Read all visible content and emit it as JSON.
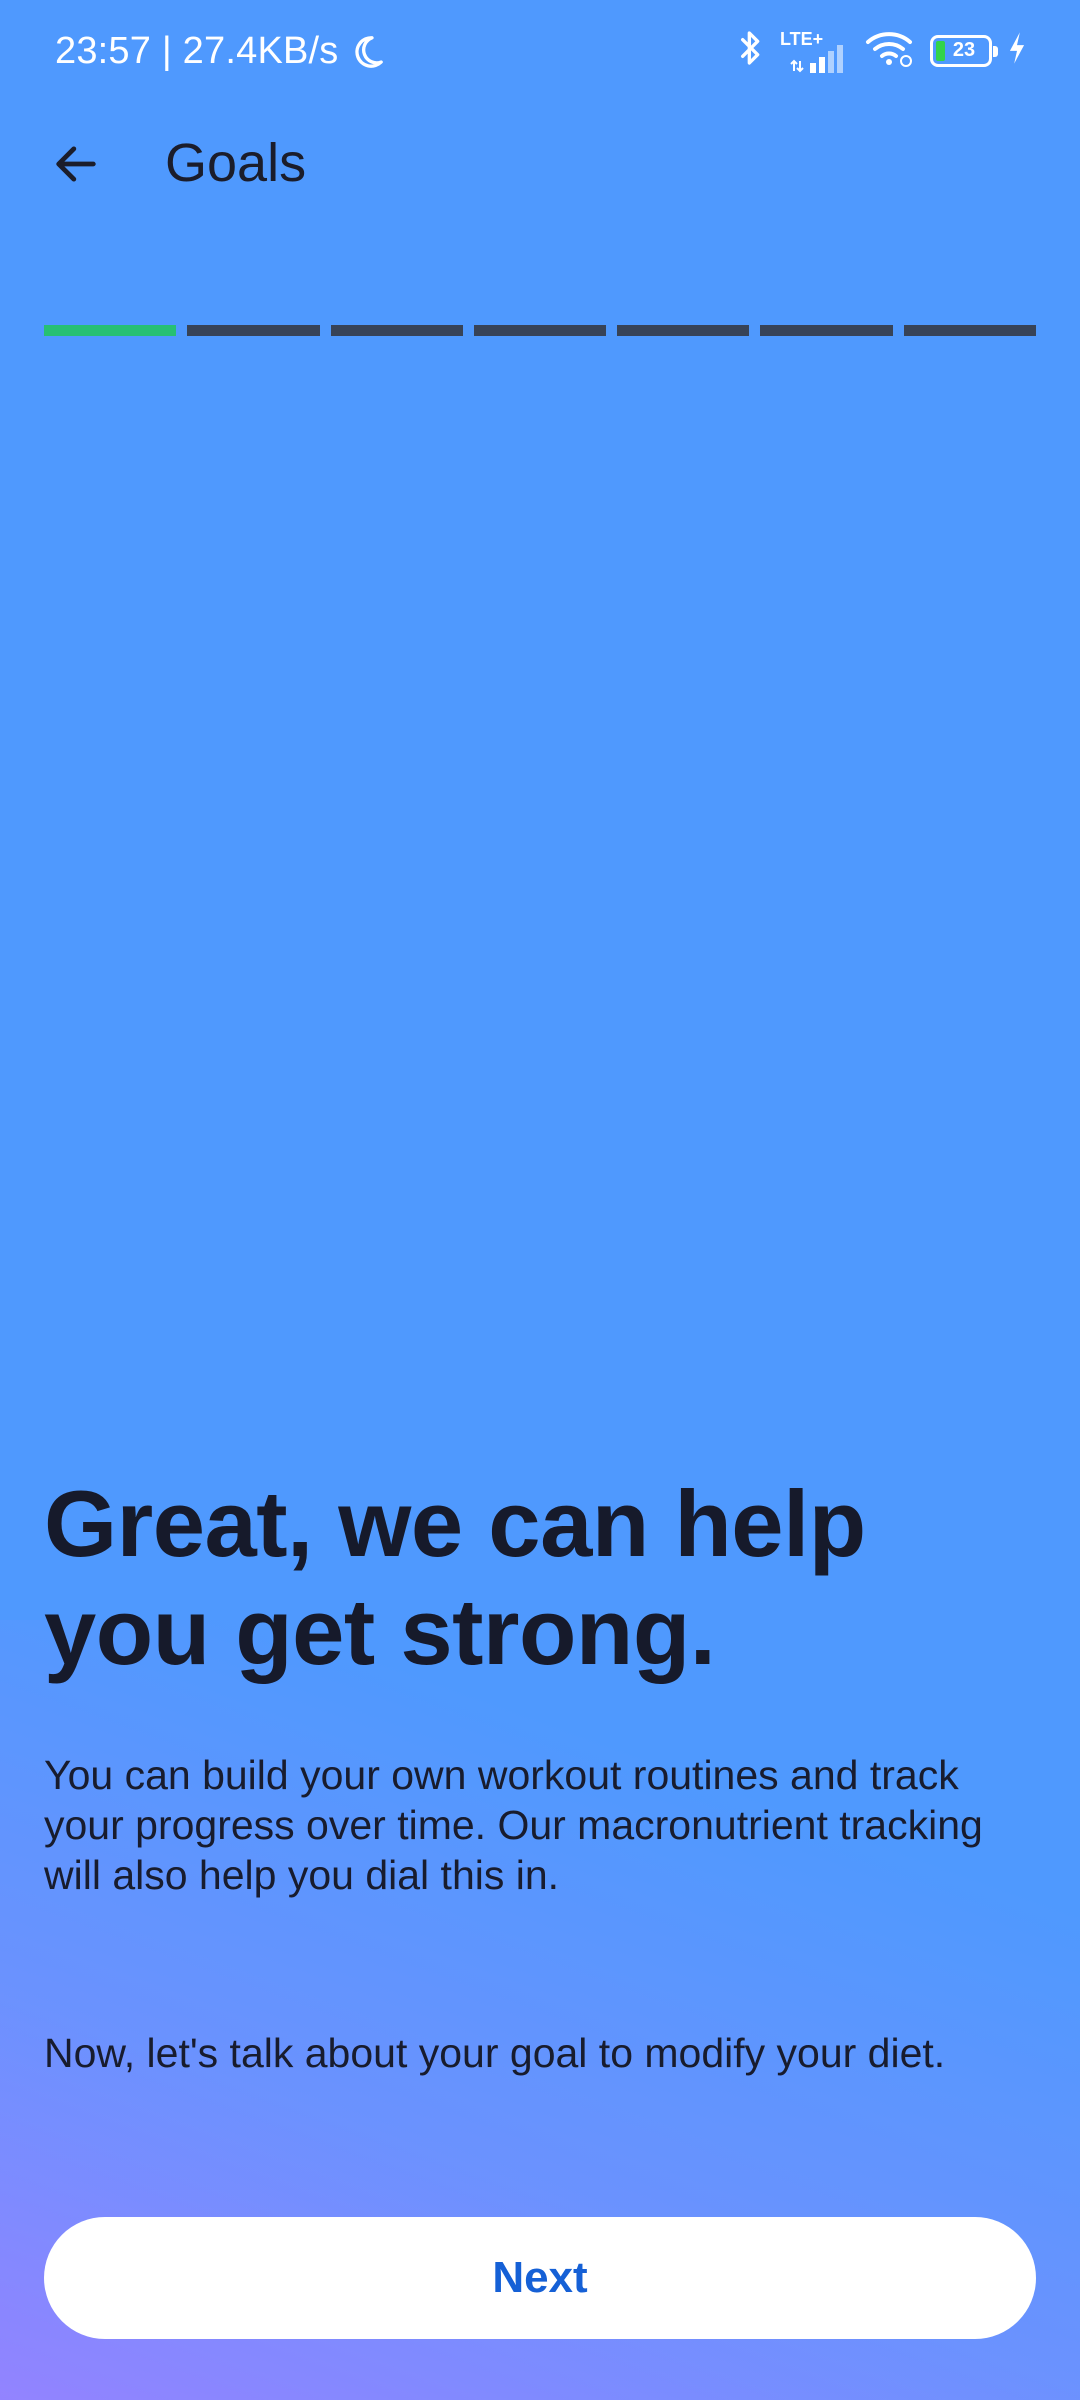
{
  "status_bar": {
    "time_speed": "23:57 | 27.4KB/s",
    "network_type": "LTE+",
    "battery_level": "23",
    "icons": [
      "moon-icon",
      "bluetooth-icon",
      "signal-icon",
      "wifi-icon",
      "battery-icon",
      "charging-icon"
    ]
  },
  "app_bar": {
    "title": "Goals",
    "back_icon": "arrow-left-icon"
  },
  "progress": {
    "total_steps": 7,
    "current_step": 1,
    "active_color": "#27c073",
    "inactive_color": "#374357"
  },
  "content": {
    "headline": "Great, we can help you get strong.",
    "paragraph_1": "You can build your own workout routines and track your progress over time. Our macronutrient tracking will also help you dial this in.",
    "paragraph_2": "Now, let's talk about your goal to modify your diet."
  },
  "actions": {
    "next_label": "Next"
  },
  "colors": {
    "background": "#4f99fe",
    "gradient_accent": "#9682ff",
    "button_text": "#1560d6"
  }
}
